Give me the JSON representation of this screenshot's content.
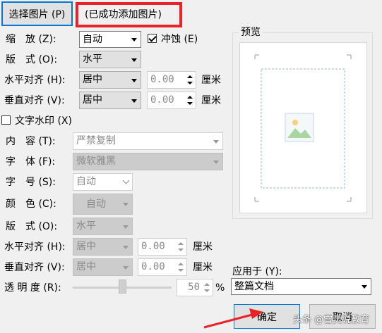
{
  "buttons": {
    "select_picture": "选择图片 (P)",
    "ok": "确定",
    "cancel": "取消"
  },
  "status": {
    "added_message": "(已成功添加图片)"
  },
  "picture_section": {
    "scale_label": "缩　放 (Z):",
    "scale_value": "自动",
    "washout_label": "冲蚀 (E)",
    "washout_checked": true,
    "layout_label": "版　式 (O):",
    "layout_value": "水平",
    "h_align_label": "水平对齐 (H):",
    "h_align_value": "居中",
    "h_offset": "0.00",
    "v_align_label": "垂直对齐 (V):",
    "v_align_value": "居中",
    "v_offset": "0.00",
    "unit": "厘米"
  },
  "text_section": {
    "checkbox_label": "文字水印 (X)",
    "checked": false,
    "content_label": "内　容 (T):",
    "content_value": "严禁复制",
    "font_label": "字　体 (F):",
    "font_value": "微软雅黑",
    "size_label": "字　号 (S):",
    "size_value": "自动",
    "color_label": "颜　色 (C):",
    "color_value": "自动",
    "layout_label": "版　式 (O):",
    "layout_value": "水平",
    "h_align_label": "水平对齐 (H):",
    "h_align_value": "居中",
    "h_offset": "0.00",
    "v_align_label": "垂直对齐 (V):",
    "v_align_value": "居中",
    "v_offset": "0.00",
    "unit": "厘米",
    "transparency_label": "透 明 度 (R):",
    "transparency_value": "50",
    "transparency_unit": "%"
  },
  "preview": {
    "title": "预览"
  },
  "apply": {
    "label": "应用于 (Y):",
    "value": "整篇文档"
  },
  "watermark_text": "头条 @雪灵说教育",
  "colors": {
    "highlight_red": "#e8242a",
    "focus_blue": "#0078d7"
  }
}
